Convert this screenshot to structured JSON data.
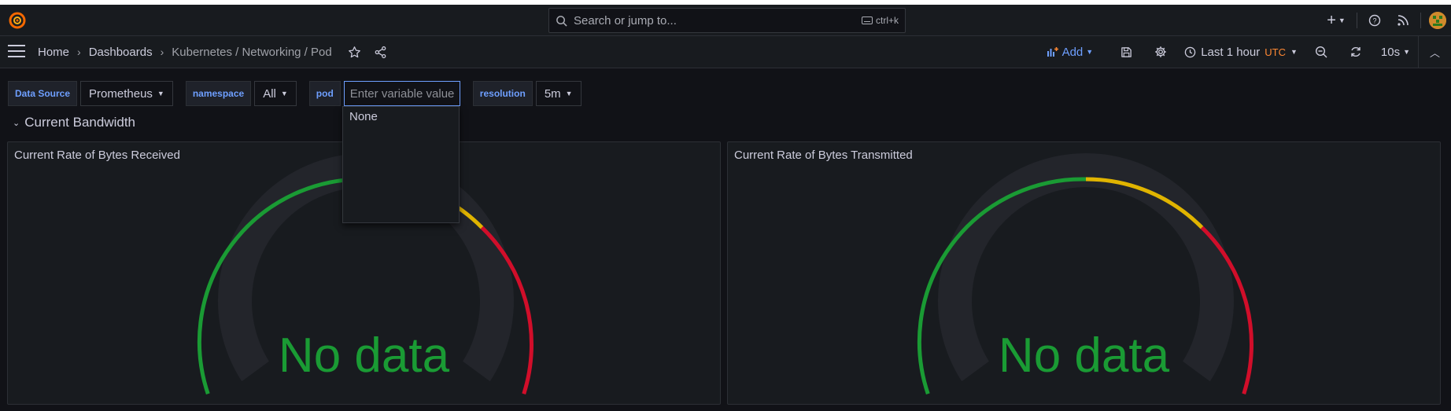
{
  "topbar": {
    "search_placeholder": "Search or jump to...",
    "search_shortcut": "ctrl+k",
    "plus_label": "+"
  },
  "breadcrumb": [
    "Home",
    "Dashboards",
    "Kubernetes / Networking / Pod"
  ],
  "toolbar": {
    "add_label": "Add",
    "time_range": "Last 1 hour",
    "timezone": "UTC",
    "refresh_interval": "10s"
  },
  "variables": {
    "datasource_label": "Data Source",
    "datasource_value": "Prometheus",
    "namespace_label": "namespace",
    "namespace_value": "All",
    "pod_label": "pod",
    "pod_placeholder": "Enter variable value",
    "pod_options": [
      "None"
    ],
    "resolution_label": "resolution",
    "resolution_value": "5m"
  },
  "row": {
    "title": "Current Bandwidth"
  },
  "panels": [
    {
      "title": "Current Rate of Bytes Received",
      "value_text": "No data"
    },
    {
      "title": "Current Rate of Bytes Transmitted",
      "value_text": "No data"
    }
  ],
  "colors": {
    "accent": "#6e9fff",
    "threshold_green": "#1a9b34",
    "threshold_yellow": "#e0b400",
    "threshold_red": "#d10e2a",
    "utc": "#ff8833"
  },
  "icons": {
    "logo": "grafana-logo",
    "star": "star-icon",
    "share": "share-icon",
    "save": "save-icon",
    "settings": "gear-icon",
    "clock": "clock-icon",
    "zoom_out": "zoom-out-icon",
    "refresh": "refresh-icon",
    "help": "help-icon",
    "news": "rss-icon"
  }
}
